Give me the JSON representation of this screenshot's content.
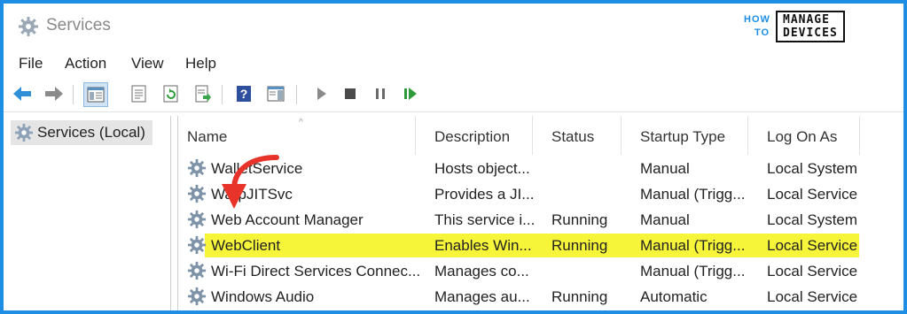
{
  "window": {
    "title": "Services",
    "icon": "gear-icon"
  },
  "logo": {
    "line1": "HOW",
    "line2": "TO",
    "box_line1": "MANAGE",
    "box_line2": "DEVICES"
  },
  "menu": [
    {
      "label": "File"
    },
    {
      "label": "Action"
    },
    {
      "label": "View"
    },
    {
      "label": "Help"
    }
  ],
  "toolbar": {
    "buttons": [
      "back-arrow-icon",
      "forward-arrow-icon",
      "show-hide-tree-icon",
      "properties-icon",
      "refresh-icon",
      "export-list-icon",
      "help-icon",
      "show-pane-icon",
      "start-service-icon",
      "stop-service-icon",
      "pause-service-icon",
      "restart-service-icon"
    ]
  },
  "tree": {
    "selected_label": "Services (Local)"
  },
  "table": {
    "columns": [
      {
        "label": "Name"
      },
      {
        "label": "Description"
      },
      {
        "label": "Status"
      },
      {
        "label": "Startup Type"
      },
      {
        "label": "Log On As"
      }
    ],
    "sort_indicator": "^",
    "rows": [
      {
        "name": "WalletService",
        "description": "Hosts object...",
        "status": "",
        "startup": "Manual",
        "logon": "Local System",
        "highlighted": false
      },
      {
        "name": "WarpJITSvc",
        "description": "Provides a JI...",
        "status": "",
        "startup": "Manual (Trigg...",
        "logon": "Local Service",
        "highlighted": false
      },
      {
        "name": "Web Account Manager",
        "description": "This service i...",
        "status": "Running",
        "startup": "Manual",
        "logon": "Local System",
        "highlighted": false
      },
      {
        "name": "WebClient",
        "description": "Enables Win...",
        "status": "Running",
        "startup": "Manual (Trigg...",
        "logon": "Local Service",
        "highlighted": true
      },
      {
        "name": "Wi-Fi Direct Services Connec...",
        "description": "Manages co...",
        "status": "",
        "startup": "Manual (Trigg...",
        "logon": "Local Service",
        "highlighted": false
      },
      {
        "name": "Windows Audio",
        "description": "Manages au...",
        "status": "Running",
        "startup": "Automatic",
        "logon": "Local Service",
        "highlighted": false
      }
    ]
  },
  "colors": {
    "frame_border": "#1e8ee5",
    "highlight": "#f6f53a",
    "annotation_arrow": "#e8332a"
  }
}
